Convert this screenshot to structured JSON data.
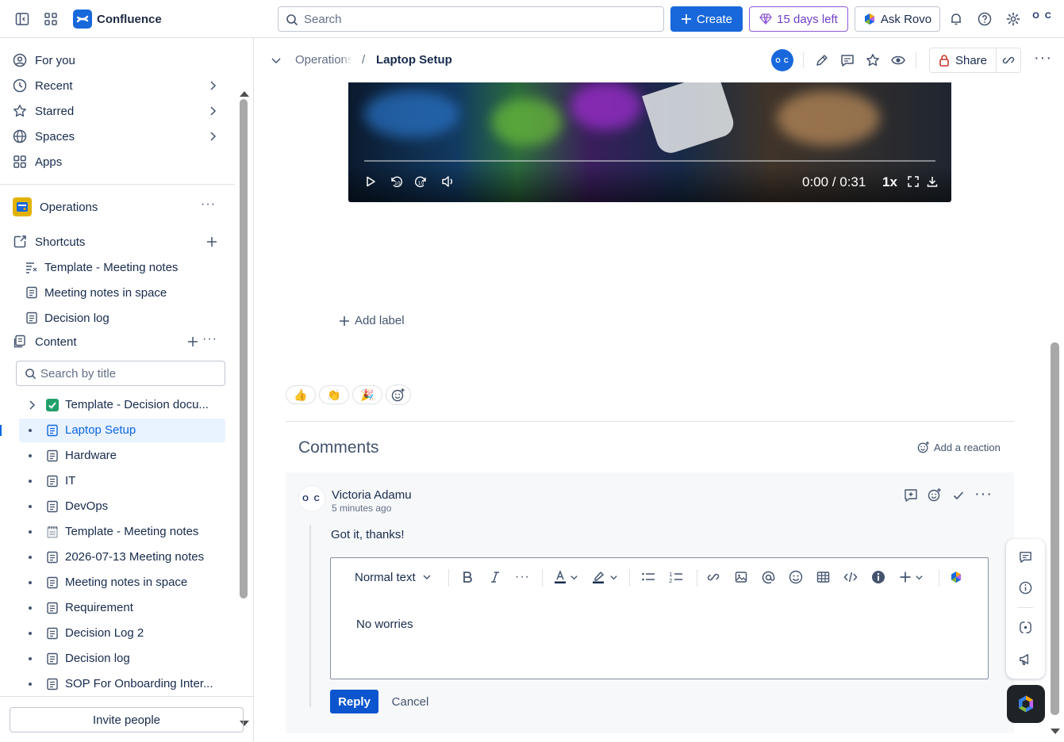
{
  "app": {
    "name": "Confluence"
  },
  "topbar": {
    "search_placeholder": "Search",
    "create_label": "Create",
    "trial_label": "15 days left",
    "rovo_label": "Ask Rovo",
    "profile_initials": "O C"
  },
  "sidebar": {
    "nav": [
      {
        "label": "For you"
      },
      {
        "label": "Recent"
      },
      {
        "label": "Starred"
      },
      {
        "label": "Spaces"
      },
      {
        "label": "Apps"
      }
    ],
    "space_name": "Operations",
    "shortcuts_label": "Shortcuts",
    "shortcuts": [
      {
        "label": "Template - Meeting notes"
      },
      {
        "label": "Meeting notes in space"
      },
      {
        "label": "Decision log"
      }
    ],
    "content_label": "Content",
    "content_search_placeholder": "Search by title",
    "tree": [
      {
        "label": "Template - Decision docu..."
      },
      {
        "label": "Laptop Setup"
      },
      {
        "label": "Hardware"
      },
      {
        "label": "IT"
      },
      {
        "label": "DevOps"
      },
      {
        "label": "Template - Meeting notes"
      },
      {
        "label": "2026-07-13 Meeting notes"
      },
      {
        "label": "Meeting notes in space"
      },
      {
        "label": "Requirement"
      },
      {
        "label": "Decision Log 2"
      },
      {
        "label": "Decision log"
      },
      {
        "label": "SOP For Onboarding Inter..."
      }
    ],
    "invite_label": "Invite people"
  },
  "page": {
    "breadcrumb_parent": "Operations",
    "breadcrumb_sep": "/",
    "title": "Laptop Setup",
    "share_label": "Share",
    "video": {
      "time": "0:00 / 0:31",
      "speed": "1x"
    },
    "add_label": "Add label",
    "reactions": [
      "👍",
      "👏",
      "🎉"
    ]
  },
  "comments": {
    "heading": "Comments",
    "add_reaction_label": "Add a reaction",
    "items": [
      {
        "author": "Victoria Adamu",
        "time": "5 minutes ago",
        "body": "Got it, thanks!"
      }
    ],
    "editor": {
      "text_style": "Normal text",
      "draft": "No worries"
    },
    "reply_label": "Reply",
    "cancel_label": "Cancel"
  },
  "colors": {
    "brand": "#1868db",
    "selected_bg": "#e9f2ff",
    "trial": "#6e3fc6"
  }
}
